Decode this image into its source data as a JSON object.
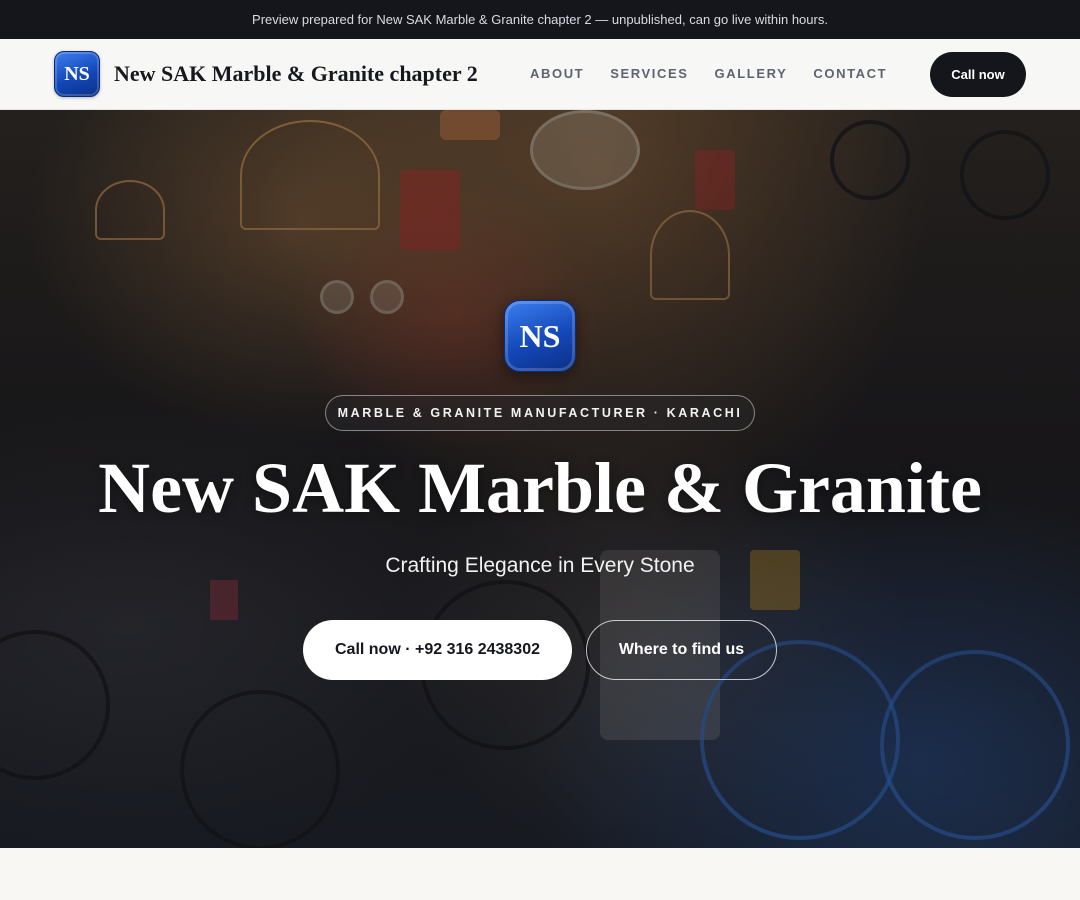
{
  "announcement": {
    "text": "Preview prepared for New SAK Marble & Granite chapter 2 — unpublished, can go live within hours."
  },
  "header": {
    "logo_initials": "NS",
    "brand_name": "New SAK Marble & Granite chapter 2",
    "nav": [
      "ABOUT",
      "SERVICES",
      "GALLERY",
      "CONTACT"
    ],
    "cta_label": "Call now"
  },
  "hero": {
    "logo_initials": "NS",
    "eyebrow": "MARBLE & GRANITE MANUFACTURER · KARACHI",
    "title": "New SAK Marble & Granite",
    "tagline": "Crafting Elegance in Every Stone",
    "primary_cta": "Call now · +92 316 2438302",
    "secondary_cta": "Where to find us",
    "background_image": "market-shop-photo"
  },
  "colors": {
    "dark": "#14161c",
    "logo_blue": "#1448b8",
    "page_bg": "#f8f7f4",
    "white": "#ffffff"
  }
}
